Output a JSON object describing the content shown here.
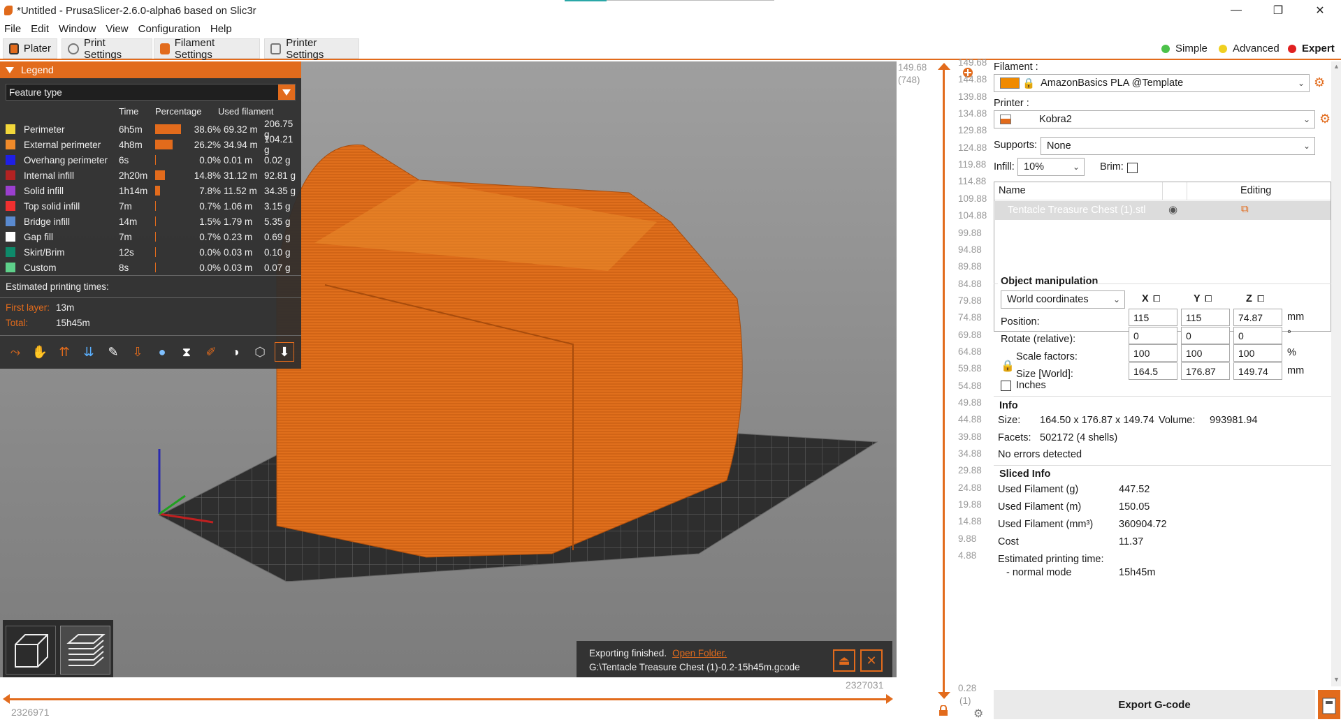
{
  "window": {
    "title": "*Untitled - PrusaSlicer-2.6.0-alpha6 based on Slic3r",
    "minimize": "—",
    "maximize": "❐",
    "close": "✕"
  },
  "menu": [
    "File",
    "Edit",
    "Window",
    "View",
    "Configuration",
    "Help"
  ],
  "tabs": [
    {
      "label": "Plater"
    },
    {
      "label": "Print Settings"
    },
    {
      "label": "Filament Settings"
    },
    {
      "label": "Printer Settings"
    }
  ],
  "modes": [
    {
      "label": "Simple",
      "color": "#4cc24a"
    },
    {
      "label": "Advanced",
      "color": "#f0d020"
    },
    {
      "label": "Expert",
      "color": "#e02020"
    }
  ],
  "legend": {
    "title": "Legend",
    "view_type": "Feature type",
    "columns": [
      "Time",
      "Percentage",
      "Used filament"
    ],
    "rows": [
      {
        "name": "Perimeter",
        "color": "#f2d73a",
        "time": "6h5m",
        "pct": "38.6%",
        "bar": 0.386,
        "m": "69.32 m",
        "g": "206.75 g"
      },
      {
        "name": "External perimeter",
        "color": "#f08a2a",
        "time": "4h8m",
        "pct": "26.2%",
        "bar": 0.262,
        "m": "34.94 m",
        "g": "104.21 g"
      },
      {
        "name": "Overhang perimeter",
        "color": "#1f1fe6",
        "time": "6s",
        "pct": "0.0%",
        "bar": 0,
        "m": "0.01 m",
        "g": "0.02 g"
      },
      {
        "name": "Internal infill",
        "color": "#b22222",
        "time": "2h20m",
        "pct": "14.8%",
        "bar": 0.148,
        "m": "31.12 m",
        "g": "92.81 g"
      },
      {
        "name": "Solid infill",
        "color": "#9b3fcf",
        "time": "1h14m",
        "pct": "7.8%",
        "bar": 0.078,
        "m": "11.52 m",
        "g": "34.35 g"
      },
      {
        "name": "Top solid infill",
        "color": "#f03030",
        "time": "7m",
        "pct": "0.7%",
        "bar": 0.007,
        "m": "1.06 m",
        "g": "3.15 g"
      },
      {
        "name": "Bridge infill",
        "color": "#5a8ad0",
        "time": "14m",
        "pct": "1.5%",
        "bar": 0.015,
        "m": "1.79 m",
        "g": "5.35 g"
      },
      {
        "name": "Gap fill",
        "color": "#ffffff",
        "time": "7m",
        "pct": "0.7%",
        "bar": 0.007,
        "m": "0.23 m",
        "g": "0.69 g"
      },
      {
        "name": "Skirt/Brim",
        "color": "#0e8a6a",
        "time": "12s",
        "pct": "0.0%",
        "bar": 0,
        "m": "0.03 m",
        "g": "0.10 g"
      },
      {
        "name": "Custom",
        "color": "#5ed08a",
        "time": "8s",
        "pct": "0.0%",
        "bar": 0,
        "m": "0.03 m",
        "g": "0.07 g"
      }
    ],
    "estimated_label": "Estimated printing times:",
    "first_layer_label": "First layer:",
    "first_layer_value": "13m",
    "total_label": "Total:",
    "total_value": "15h45m"
  },
  "notification": {
    "text": "Exporting finished.",
    "link": "Open Folder.",
    "path": "G:\\Tentacle Treasure Chest (1)-0.2-15h45m.gcode"
  },
  "hslider": {
    "left": "2326971",
    "right": "2327031"
  },
  "vslider": {
    "top_value": "149.68",
    "top_layer": "(748)",
    "ticks": [
      "149.68",
      "144.88",
      "139.88",
      "134.88",
      "129.88",
      "124.88",
      "119.88",
      "114.88",
      "109.88",
      "104.88",
      "99.88",
      "94.88",
      "89.88",
      "84.88",
      "79.88",
      "74.88",
      "69.88",
      "64.88",
      "59.88",
      "54.88",
      "49.88",
      "44.88",
      "39.88",
      "34.88",
      "29.88",
      "24.88",
      "19.88",
      "14.88",
      "9.88",
      "4.88",
      "0.28"
    ],
    "bottom_layer": "(1)"
  },
  "sidebar": {
    "filament_label": "Filament :",
    "filament_value": "AmazonBasics PLA @Template",
    "filament_color": "#f08a00",
    "printer_label": "Printer :",
    "printer_value": "Kobra2",
    "supports_label": "Supports:",
    "supports_value": "None",
    "infill_label": "Infill:",
    "infill_value": "10%",
    "brim_label": "Brim:",
    "list_name_header": "Name",
    "list_editing_header": "Editing",
    "object_name": "Tentacle Treasure Chest (1).stl"
  },
  "object_manipulation": {
    "title": "Object manipulation",
    "coords": "World coordinates",
    "axes": [
      "X",
      "Y",
      "Z"
    ],
    "position_label": "Position:",
    "position": [
      "115",
      "115",
      "74.87"
    ],
    "rotate_label": "Rotate (relative):",
    "rotate": [
      "0",
      "0",
      "0"
    ],
    "scale_label": "Scale factors:",
    "scale": [
      "100",
      "100",
      "100"
    ],
    "size_label": "Size [World]:",
    "size": [
      "164.5",
      "176.87",
      "149.74"
    ],
    "unit_mm": "mm",
    "unit_deg": "°",
    "unit_pct": "%",
    "inches_label": "Inches"
  },
  "info": {
    "title": "Info",
    "size_label": "Size:",
    "size_value": "164.50 x 176.87 x 149.74",
    "volume_label": "Volume:",
    "volume_value": "993981.94",
    "facets_label": "Facets:",
    "facets_value": "502172 (4 shells)",
    "errors": "No errors detected"
  },
  "sliced_info": {
    "title": "Sliced Info",
    "rows": [
      {
        "k": "Used Filament (g)",
        "v": "447.52"
      },
      {
        "k": "Used Filament (m)",
        "v": "150.05"
      },
      {
        "k": "Used Filament (mm³)",
        "v": "360904.72"
      },
      {
        "k": "Cost",
        "v": "11.37"
      }
    ],
    "est_label": "Estimated printing time:",
    "normal_mode_label": "- normal mode",
    "normal_mode_value": "15h45m"
  },
  "export_label": "Export G-code"
}
